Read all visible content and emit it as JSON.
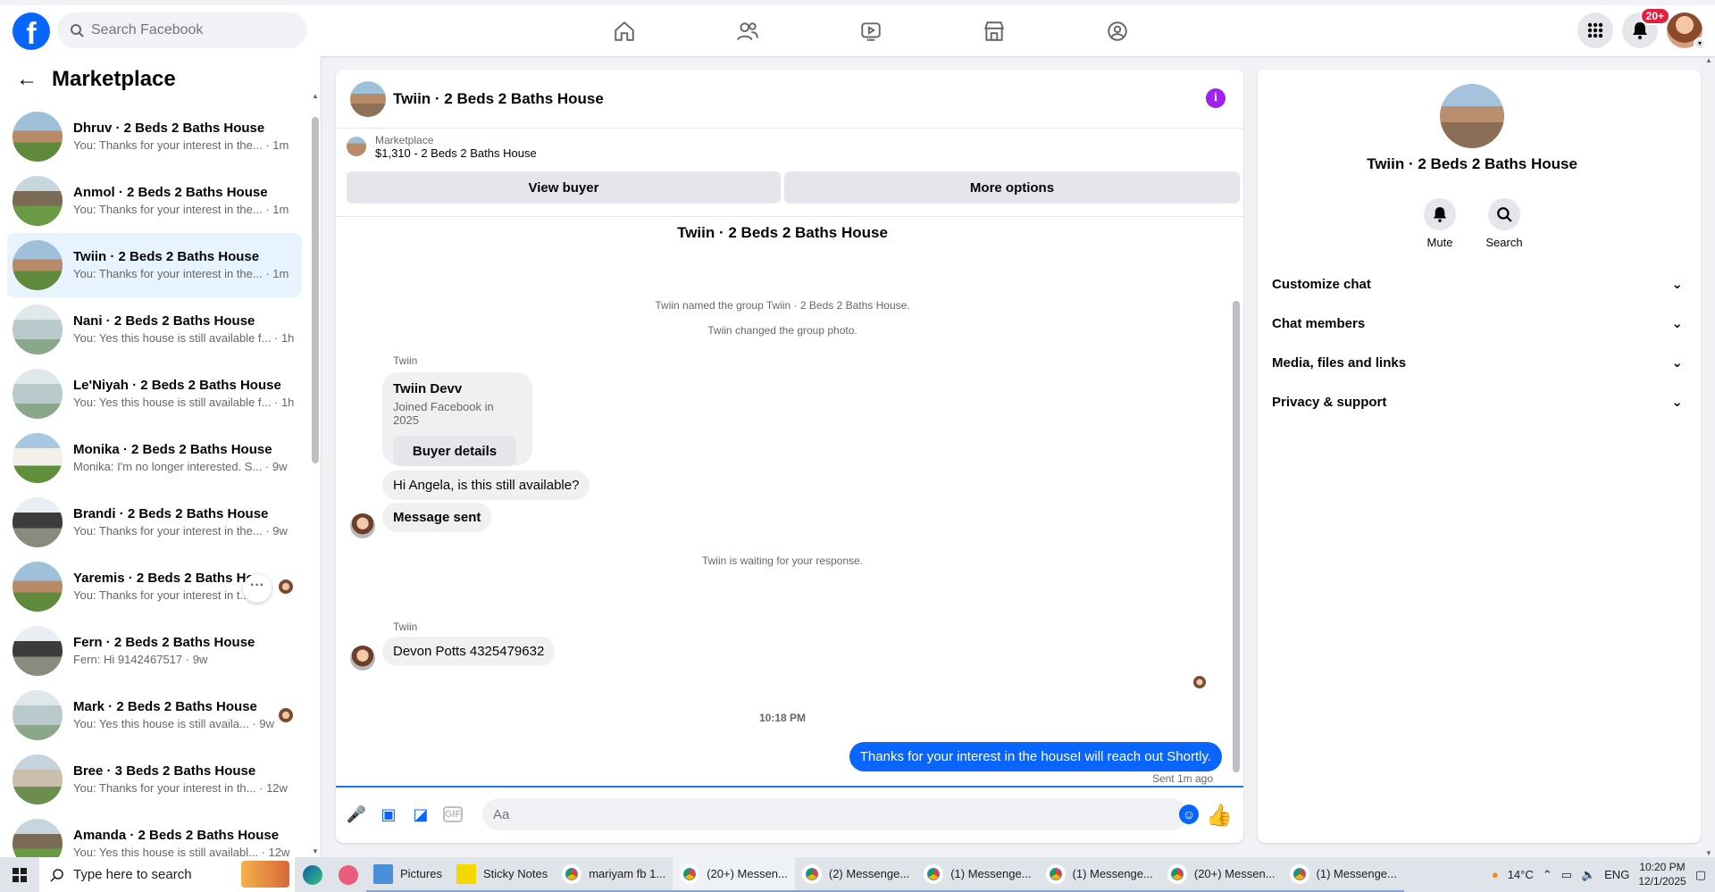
{
  "top": {
    "search_placeholder": "Search Facebook",
    "notifications_badge": "20+"
  },
  "marketplace": {
    "title": "Marketplace",
    "conversations": [
      {
        "title": "Dhruv · 2 Beds 2 Baths House",
        "preview": "You: Thanks for your interest in the...",
        "time": "1m"
      },
      {
        "title": "Anmol · 2 Beds 2 Baths House",
        "preview": "You: Thanks for your interest in the...",
        "time": "1m"
      },
      {
        "title": "Twiin · 2 Beds 2 Baths House",
        "preview": "You: Thanks for your interest in the...",
        "time": "1m"
      },
      {
        "title": "Nani · 2 Beds 2 Baths House",
        "preview": "You: Yes this house is still available f...",
        "time": "1h"
      },
      {
        "title": "Le'Niyah · 2 Beds 2 Baths House",
        "preview": "You: Yes this house is still available f...",
        "time": "1h"
      },
      {
        "title": "Monika · 2 Beds 2 Baths House",
        "preview": "Monika: I'm no longer interested. S...",
        "time": "9w"
      },
      {
        "title": "Brandi · 2 Beds 2 Baths House",
        "preview": "You: Thanks for your interest in the...",
        "time": "9w"
      },
      {
        "title": "Yaremis · 2 Beds 2 Baths Hou",
        "preview": "You: Thanks for your interest in t...",
        "time": ""
      },
      {
        "title": "Fern · 2 Beds 2 Baths House",
        "preview": "Fern: Hi 9142467517",
        "time": "9w"
      },
      {
        "title": "Mark · 2 Beds 2 Baths House",
        "preview": "You: Yes this house is still availa...",
        "time": "9w"
      },
      {
        "title": "Bree · 3 Beds 2 Baths House",
        "preview": "You: Thanks for your interest in th...",
        "time": "12w"
      },
      {
        "title": "Amanda · 2 Beds 2 Baths House",
        "preview": "You: Yes this house is still availabl...",
        "time": "12w"
      }
    ]
  },
  "chat": {
    "name": "Twiin · 2 Beds 2 Baths House",
    "listing_label": "Marketplace",
    "listing_price": "$1,310 - 2 Beds 2 Baths House",
    "view_buyer": "View buyer",
    "more_options": "More options",
    "group_title": "Twiin · 2 Beds 2 Baths House",
    "sys1": "Twiin named the group Twiin · 2 Beds 2 Baths House.",
    "sys2": "Twiin changed the group photo.",
    "sender": "Twiin",
    "card_name": "Twiin Devv",
    "card_joined": "Joined Facebook in 2025",
    "card_button": "Buyer details",
    "msg1": "Hi Angela, is this still available?",
    "msg2": "Message sent",
    "waiting": "Twiin is waiting for your response.",
    "sender2": "Twiin",
    "msg3": "Devon Potts 4325479632",
    "time_sep": "10:18 PM",
    "out_msg": "Thanks for your interest in the houseI will reach out Shortly.",
    "sent_status": "Sent 1m ago",
    "composer_placeholder": "Aa"
  },
  "info": {
    "name": "Twiin · 2 Beds 2 Baths House",
    "mute": "Mute",
    "search": "Search",
    "sections": [
      "Customize chat",
      "Chat members",
      "Media, files and links",
      "Privacy & support"
    ]
  },
  "taskbar": {
    "search_placeholder": "Type here to search",
    "tasks": [
      "Pictures",
      "Sticky Notes",
      "mariyam fb 1...",
      "(20+) Messen...",
      "(2) Messenge...",
      "(1) Messenge...",
      "(1) Messenge...",
      "(20+) Messen...",
      "(1) Messenge..."
    ],
    "weather": "14°C",
    "lang": "ENG",
    "time": "10:20 PM",
    "date": "12/1/2025"
  },
  "colors": {
    "brand": "#0866ff",
    "info_icon": "#a020f0",
    "badge": "#e41e3f"
  }
}
